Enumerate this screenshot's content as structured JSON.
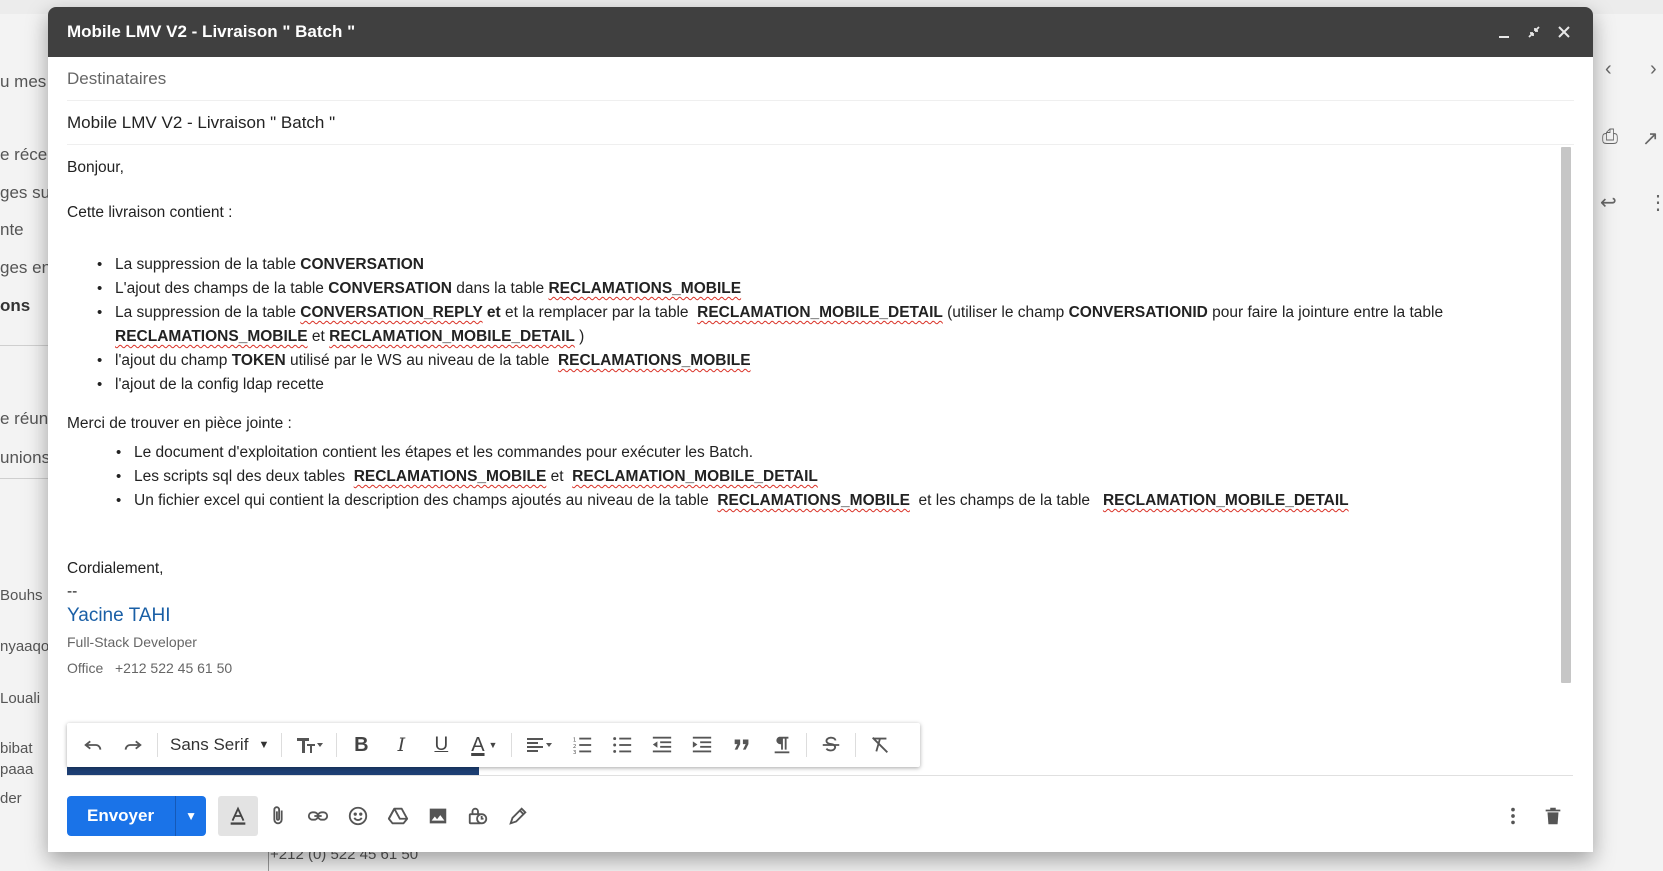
{
  "background": {
    "left_items": [
      {
        "text": "u mes",
        "style": "normal"
      },
      {
        "text": "e récep",
        "style": "normal"
      },
      {
        "text": "ges sui",
        "style": "normal"
      },
      {
        "text": "nte",
        "style": "normal"
      },
      {
        "text": "ges env",
        "style": "normal"
      },
      {
        "text": "ons",
        "style": "bold"
      },
      {
        "text": "e réun",
        "style": "normal"
      },
      {
        "text": "unions",
        "style": "normal"
      },
      {
        "text": "Bouhs",
        "style": "small"
      },
      {
        "text": "nyaaqo",
        "style": "small"
      },
      {
        "text": "Louali",
        "style": "small"
      },
      {
        "text": "bibat",
        "style": "small"
      },
      {
        "text": "paaa",
        "style": "small"
      },
      {
        "text": "der",
        "style": "small"
      }
    ],
    "bottom_text": "+212 (0) 522 45 61 50"
  },
  "compose": {
    "window_title": "Mobile LMV V2 - Livraison \" Batch \"",
    "recipients_placeholder": "Destinataires",
    "subject": "Mobile LMV V2 - Livraison \" Batch \"",
    "body": {
      "greeting": "Bonjour,",
      "intro": "Cette livraison contient :",
      "list1": [
        [
          {
            "t": "La suppression de la table "
          },
          {
            "t": "CONVERSATION",
            "b": true
          }
        ],
        [
          {
            "t": "L'ajout des champs de la table "
          },
          {
            "t": "CONVERSATION",
            "b": true
          },
          {
            "t": " dans la table "
          },
          {
            "t": "RECLAMATIONS_MOBILE",
            "b": true,
            "sq": true
          }
        ],
        [
          {
            "t": "La suppression de la table "
          },
          {
            "t": "CONVERSATION_REPLY",
            "b": true,
            "sq": true
          },
          {
            "t": " et",
            "b": true
          },
          {
            "t": " et la remplacer par la table  "
          },
          {
            "t": "RECLAMATION_MOBILE_DETAIL",
            "b": true,
            "sq": true
          },
          {
            "t": " (utiliser le champ "
          },
          {
            "t": "CONVERSATIONID",
            "b": true
          },
          {
            "t": " pour faire la jointure entre la table "
          },
          {
            "t": "RECLAMATIONS_MOBILE",
            "b": true,
            "sq": true
          },
          {
            "t": " et "
          },
          {
            "t": "RECLAMATION_MOBILE_DETAIL",
            "b": true,
            "sq": true
          },
          {
            "t": " )"
          }
        ],
        [
          {
            "t": "l'ajout du champ "
          },
          {
            "t": "TOKEN",
            "b": true
          },
          {
            "t": " utilisé par le WS au niveau de la table  "
          },
          {
            "t": "RECLAMATIONS_MOBILE",
            "b": true,
            "sq": true
          }
        ],
        [
          {
            "t": "l'ajout de la config ldap recette"
          }
        ]
      ],
      "attachments_intro": "Merci de trouver en pièce jointe :",
      "list2": [
        [
          {
            "t": "Le document d'exploitation contient les étapes et les commandes pour exécuter les Batch."
          }
        ],
        [
          {
            "t": "Les scripts sql des deux tables  "
          },
          {
            "t": "RECLAMATIONS_MOBILE",
            "b": true,
            "sq": true
          },
          {
            "t": " et  "
          },
          {
            "t": "RECLAMATION_MOBILE_DETAIL",
            "b": true,
            "sq": true
          }
        ],
        [
          {
            "t": "Un fichier excel qui contient la description des champs ajoutés au niveau de la table  "
          },
          {
            "t": "RECLAMATIONS_MOBILE",
            "b": true,
            "sq": true
          },
          {
            "t": "  et les champs de la table   "
          },
          {
            "t": "RECLAMATION_MOBILE_DETAIL",
            "b": true,
            "sq": true
          }
        ]
      ],
      "closing": "Cordialement,",
      "sig_separator": "--",
      "sig_name": "Yacine TAHI",
      "sig_role": "Full-Stack Developer",
      "sig_phone": "Office   +212 522 45 61 50"
    },
    "format_toolbar": {
      "font_family": "Sans Serif",
      "bold": "B",
      "italic": "I",
      "underline": "U",
      "text_color": "A"
    },
    "send_label": "Envoyer"
  },
  "colors": {
    "accent": "#1a73e8",
    "title_bar": "#404040",
    "signature": "#1a5fa6",
    "spellcheck": "#d93025"
  }
}
